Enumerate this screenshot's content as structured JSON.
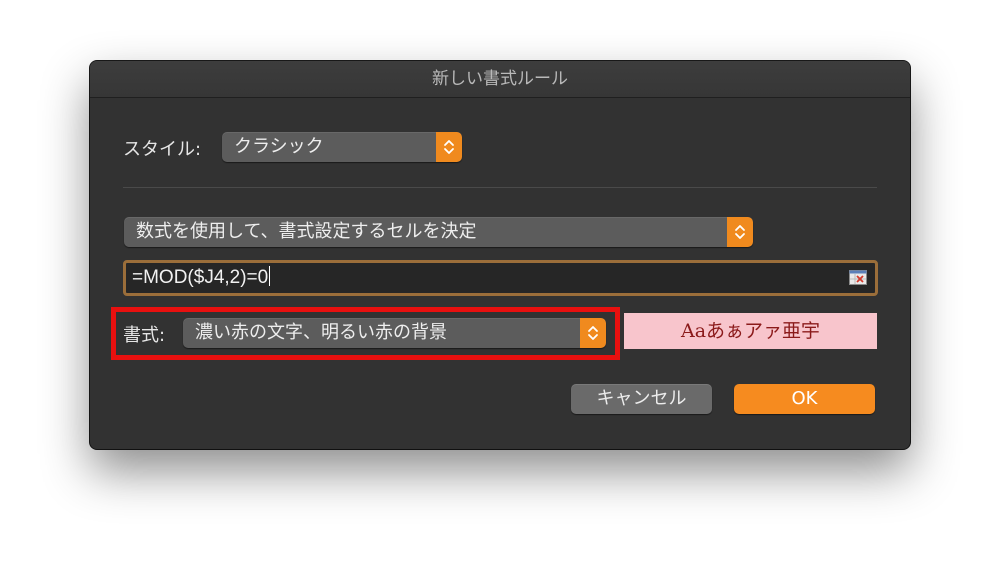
{
  "dialog": {
    "title": "新しい書式ルール"
  },
  "style_row": {
    "label": "スタイル:",
    "selected": "クラシック"
  },
  "rule_type": {
    "selected": "数式を使用して、書式設定するセルを決定"
  },
  "formula": {
    "value": "=MOD($J4,2)=0"
  },
  "format_row": {
    "label": "書式:",
    "selected": "濃い赤の文字、明るい赤の背景",
    "preview_text": "Aaあぁアァ亜宇"
  },
  "buttons": {
    "cancel_label": "キャンセル",
    "ok_label": "OK"
  },
  "colors": {
    "accent": "#f68b1f",
    "highlight_box": "#e8100f",
    "preview_background": "#f8c5cc",
    "preview_text": "#8b1a1a",
    "formula_border": "#9b6e3a"
  },
  "icons": {
    "popup_stepper": "updown-chevron-icon",
    "range_select": "collapse-range-icon"
  }
}
